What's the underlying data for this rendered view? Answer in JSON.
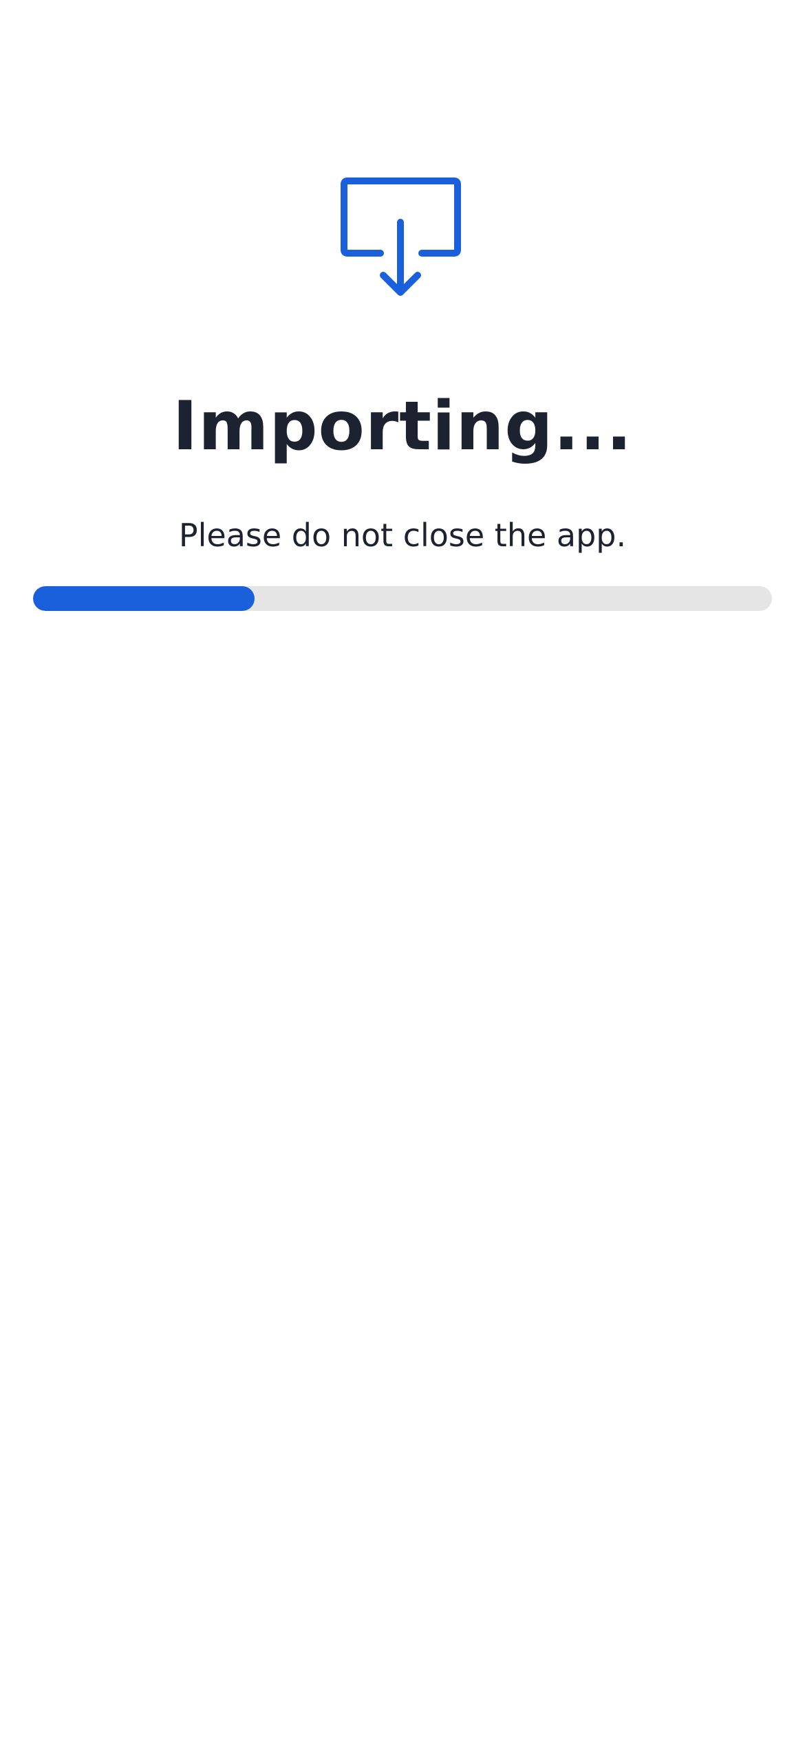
{
  "import_screen": {
    "icon": "import-tray-arrow-down-icon",
    "title": "Importing...",
    "subtitle": "Please do not close the app.",
    "progress_percent": 30
  },
  "colors": {
    "accent": "#1a5fdc",
    "track": "#e5e5e5",
    "text": "#1d2230",
    "background": "#ffffff"
  }
}
